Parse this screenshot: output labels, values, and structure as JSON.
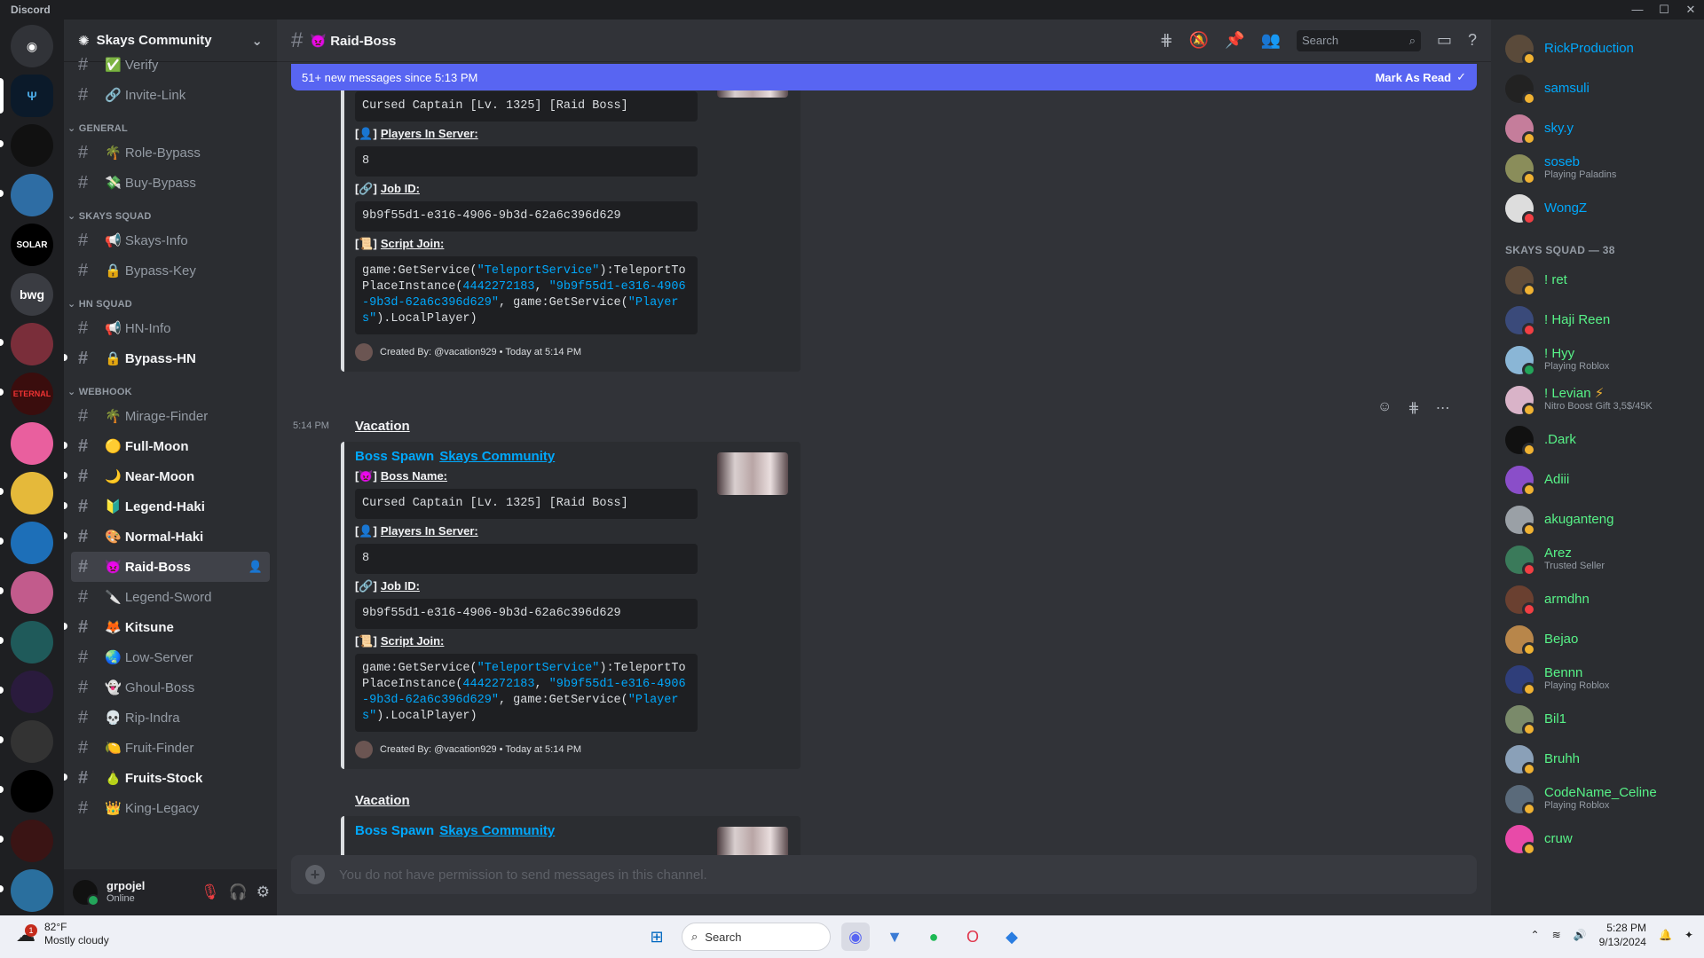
{
  "app": {
    "title": "Discord"
  },
  "server": {
    "name": "Skays Community"
  },
  "channels": {
    "top": [
      {
        "name": "✅ Verify"
      },
      {
        "name": "🔗 Invite-Link"
      }
    ],
    "cat_general": "GENERAL",
    "general": [
      {
        "name": "🌴 Role-Bypass"
      },
      {
        "name": "💸 Buy-Bypass"
      }
    ],
    "cat_skays": "SKAYS SQUAD",
    "skays": [
      {
        "name": "📢 Skays-Info"
      },
      {
        "name": "🔒 Bypass-Key"
      }
    ],
    "cat_hn": "HN SQUAD",
    "hn": [
      {
        "name": "📢 HN-Info"
      },
      {
        "name": "🔒 Bypass-HN"
      }
    ],
    "cat_webhook": "WEBHOOK",
    "webhook": [
      {
        "name": "🌴 Mirage-Finder"
      },
      {
        "name": "🟡 Full-Moon"
      },
      {
        "name": "🌙 Near-Moon"
      },
      {
        "name": "🔰 Legend-Haki"
      },
      {
        "name": "🎨 Normal-Haki"
      },
      {
        "name": "👿 Raid-Boss"
      },
      {
        "name": "🔪 Legend-Sword"
      },
      {
        "name": "🦊 Kitsune"
      },
      {
        "name": "🌏 Low-Server"
      },
      {
        "name": "👻 Ghoul-Boss"
      },
      {
        "name": "💀 Rip-Indra"
      },
      {
        "name": "🍋 Fruit-Finder"
      },
      {
        "name": "🍐 Fruits-Stock"
      },
      {
        "name": "👑 King-Legacy"
      }
    ]
  },
  "user": {
    "name": "grpojel",
    "status": "Online"
  },
  "channel_header": {
    "title": "👿 Raid-Boss",
    "search_placeholder": "Search"
  },
  "banner": {
    "text": "51+ new messages since 5:13 PM",
    "action": "Mark As Read"
  },
  "message": {
    "time": "5:14 PM",
    "author": "Vacation",
    "embed_title": "Boss Spawn",
    "embed_link": "Skays Community",
    "boss_label": "Boss Name:",
    "boss_value": "Cursed Captain [Lv. 1325] [Raid Boss]",
    "players_label": "Players In Server:",
    "players_value": "8",
    "job_label": "Job ID:",
    "job_value": "9b9f55d1-e316-4906-9b3d-62a6c396d629",
    "script_label": "Script Join:",
    "script_a": "game:GetService(",
    "script_b": "\"TeleportService\"",
    "script_c": "):TeleportToPlaceInstance(",
    "script_d": "4442272183",
    "script_e": ", ",
    "script_f": "\"9b9f55d1-e316-4906-9b3d-62a6c396d629\"",
    "script_g": ", game:GetService(",
    "script_h": "\"Players\"",
    "script_i": ").LocalPlayer)",
    "footer": "Created By: @vacation929 • Today at 5:14 PM"
  },
  "composer": {
    "placeholder": "You do not have permission to send messages in this channel."
  },
  "members": {
    "list1": [
      {
        "name": "RickProduction",
        "sub": ""
      },
      {
        "name": "samsuli",
        "sub": ""
      },
      {
        "name": "sky.y",
        "sub": ""
      },
      {
        "name": "soseb",
        "sub": "Playing Paladins"
      },
      {
        "name": "WongZ",
        "sub": ""
      }
    ],
    "cat2": "SKAYS SQUAD — 38",
    "list2": [
      {
        "name": "! ret",
        "sub": ""
      },
      {
        "name": "! Haji Reen",
        "sub": ""
      },
      {
        "name": "! Hyy",
        "sub": "Playing Roblox"
      },
      {
        "name": "! Levian",
        "sub": "Nitro Boost Gift 3,5$/45K"
      },
      {
        "name": ".Dark",
        "sub": ""
      },
      {
        "name": "Adiii",
        "sub": ""
      },
      {
        "name": "akuganteng",
        "sub": ""
      },
      {
        "name": "Arez",
        "sub": "Trusted Seller"
      },
      {
        "name": "armdhn",
        "sub": ""
      },
      {
        "name": "Bejao",
        "sub": ""
      },
      {
        "name": "Bennn",
        "sub": "Playing Roblox"
      },
      {
        "name": "Bil1",
        "sub": ""
      },
      {
        "name": "Bruhh",
        "sub": ""
      },
      {
        "name": "CodeName_Celine",
        "sub": "Playing Roblox"
      },
      {
        "name": "cruw",
        "sub": ""
      }
    ]
  },
  "taskbar": {
    "temp": "82°F",
    "weather": "Mostly cloudy",
    "search": "Search",
    "time": "5:28 PM",
    "date": "9/13/2024",
    "badge": "1"
  }
}
